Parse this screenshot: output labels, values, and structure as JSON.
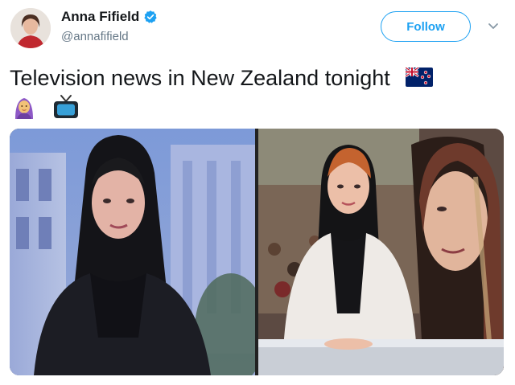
{
  "author": {
    "name": "Anna Fifield",
    "handle": "@annafifield",
    "verified": true
  },
  "actions": {
    "follow_label": "Follow"
  },
  "tweet": {
    "text": "Television news in New Zealand tonight"
  },
  "icons": {
    "verified": "verified-badge-icon",
    "caret": "chevron-down-icon",
    "flag": "new-zealand-flag-icon",
    "headscarf": "person-with-headscarf-icon",
    "tv": "television-icon"
  },
  "colors": {
    "accent": "#1da1f2",
    "text": "#14171a",
    "secondary_text": "#657786"
  }
}
